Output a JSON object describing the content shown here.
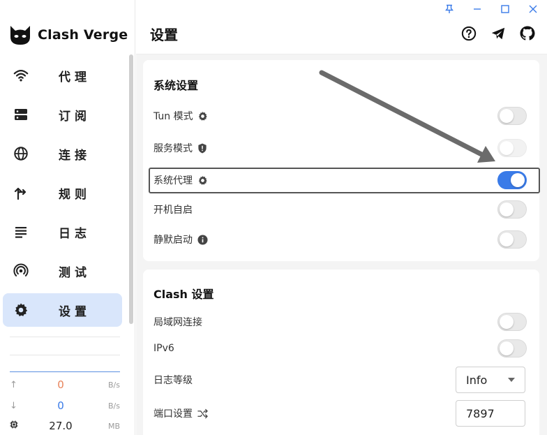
{
  "app": {
    "name": "Clash Verge"
  },
  "sidebar": {
    "items": [
      {
        "label": "代理",
        "icon": "wifi-icon"
      },
      {
        "label": "订阅",
        "icon": "server-icon"
      },
      {
        "label": "连接",
        "icon": "globe-icon"
      },
      {
        "label": "规则",
        "icon": "fork-icon"
      },
      {
        "label": "日志",
        "icon": "list-icon"
      },
      {
        "label": "测试",
        "icon": "signal-icon"
      },
      {
        "label": "设置",
        "icon": "gear-icon",
        "active": true
      }
    ],
    "traffic": {
      "upload": {
        "value": "0",
        "unit": "B/s",
        "color": "#e8835a"
      },
      "download": {
        "value": "0",
        "unit": "B/s",
        "color": "#3a7be8"
      },
      "memory": {
        "value": "27.0",
        "unit": "MB"
      }
    }
  },
  "header": {
    "title": "设置",
    "icons": [
      "help-icon",
      "telegram-icon",
      "github-icon"
    ]
  },
  "window_controls": [
    "pin-icon",
    "minimize-icon",
    "maximize-icon",
    "close-icon"
  ],
  "system_settings": {
    "title": "系统设置",
    "rows": [
      {
        "label": "Tun 模式",
        "icon": "gear-icon",
        "state": "off"
      },
      {
        "label": "服务模式",
        "icon": "shield-icon",
        "state": "disabled"
      },
      {
        "label": "系统代理",
        "icon": "gear-icon",
        "state": "on"
      },
      {
        "label": "开机自启",
        "state": "off"
      },
      {
        "label": "静默启动",
        "icon": "info-icon",
        "state": "off"
      }
    ]
  },
  "clash_settings": {
    "title": "Clash 设置",
    "lan_label": "局域网连接",
    "ipv6_label": "IPv6",
    "log_level_label": "日志等级",
    "log_level_value": "Info",
    "port_label": "端口设置",
    "port_value": "7897"
  },
  "colors": {
    "accent": "#3a7be8",
    "active_nav": "#d9e6fb"
  }
}
